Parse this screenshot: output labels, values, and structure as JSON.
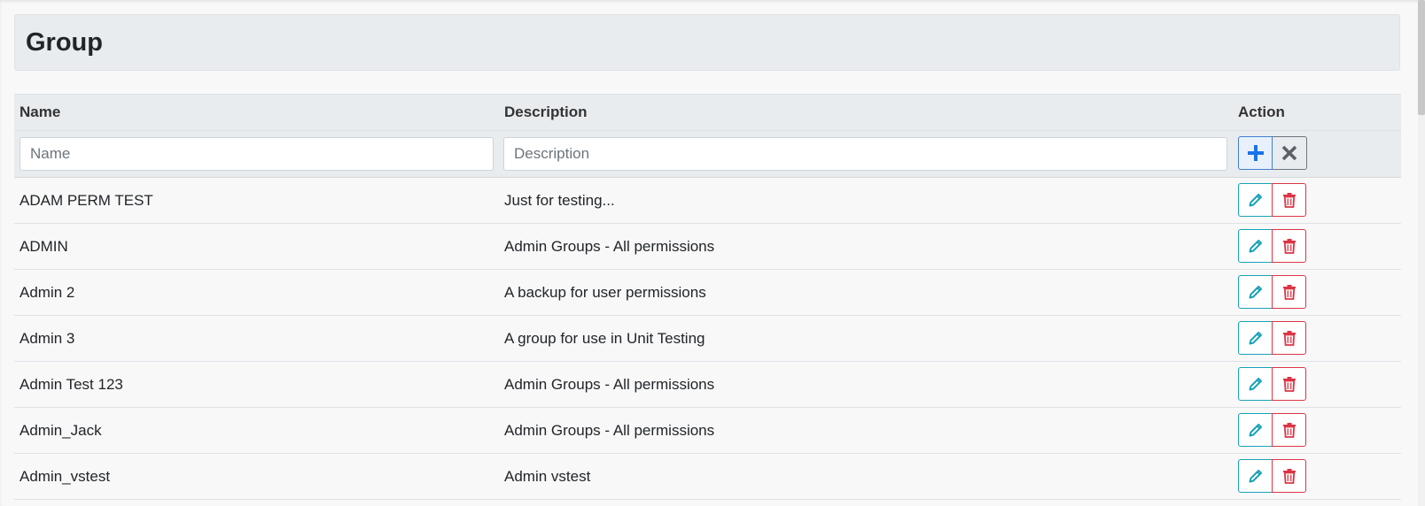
{
  "page": {
    "title": "Group"
  },
  "table": {
    "headers": {
      "name": "Name",
      "description": "Description",
      "action": "Action"
    },
    "filters": {
      "name_placeholder": "Name",
      "description_placeholder": "Description"
    },
    "rows": [
      {
        "name": "ADAM PERM TEST",
        "description": "Just for testing..."
      },
      {
        "name": "ADMIN",
        "description": "Admin Groups - All permissions"
      },
      {
        "name": "Admin 2",
        "description": "A backup for user permissions"
      },
      {
        "name": "Admin 3",
        "description": "A group for use in Unit Testing"
      },
      {
        "name": "Admin Test 123",
        "description": "Admin Groups - All permissions"
      },
      {
        "name": "Admin_Jack",
        "description": "Admin Groups - All permissions"
      },
      {
        "name": "Admin_vstest",
        "description": "Admin vstest"
      }
    ]
  },
  "icons": {
    "add": "plus-icon",
    "clear": "close-icon",
    "edit": "pencil-icon",
    "delete": "trash-icon"
  },
  "colors": {
    "add": "#1a73e8",
    "clear": "#5a6268",
    "edit": "#17a2b8",
    "delete": "#dc3545",
    "header_bg": "#e9ecef"
  }
}
